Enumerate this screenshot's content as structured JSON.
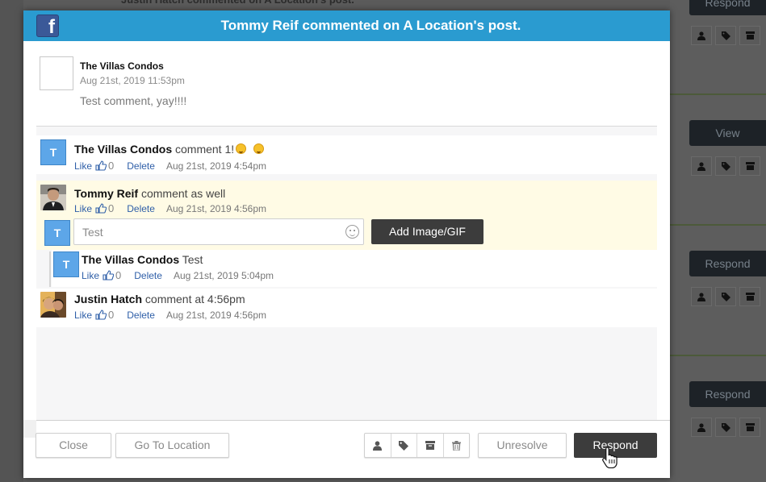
{
  "background": {
    "peek_text": "Justin Hatch commented on A Location's post.",
    "side_buttons": [
      "Respond",
      "View",
      "Respond",
      "Respond"
    ]
  },
  "modal": {
    "header_title": "Tommy Reif commented on A Location's post.",
    "brand_icon": "facebook-icon",
    "post": {
      "author": "The Villas Condos",
      "timestamp": "Aug 21st, 2019 11:53pm",
      "text": "Test comment, yay!!!!"
    },
    "comments": [
      {
        "avatar_letter": "T",
        "author": "The Villas Condos",
        "text": "comment 1!",
        "like_label": "Like",
        "likes": "0",
        "delete_label": "Delete",
        "timestamp": "Aug 21st, 2019 4:54pm"
      },
      {
        "author": "Tommy Reif",
        "text": "comment as well",
        "like_label": "Like",
        "likes": "0",
        "delete_label": "Delete",
        "timestamp": "Aug 21st, 2019 4:56pm",
        "reply": {
          "avatar_letter": "T",
          "input_value": "Test",
          "add_image_label": "Add Image/GIF"
        },
        "replies": [
          {
            "avatar_letter": "T",
            "author": "The Villas Condos",
            "text": "Test",
            "like_label": "Like",
            "likes": "0",
            "delete_label": "Delete",
            "timestamp": "Aug 21st, 2019 5:04pm"
          }
        ]
      },
      {
        "author": "Justin Hatch",
        "text": "comment at 4:56pm",
        "like_label": "Like",
        "likes": "0",
        "delete_label": "Delete",
        "timestamp": "Aug 21st, 2019 4:56pm"
      }
    ],
    "footer": {
      "close_label": "Close",
      "goto_label": "Go To Location",
      "icons": [
        "user-icon",
        "tag-icon",
        "archive-icon",
        "trash-icon"
      ],
      "unresolve_label": "Unresolve",
      "respond_label": "Respond"
    }
  }
}
